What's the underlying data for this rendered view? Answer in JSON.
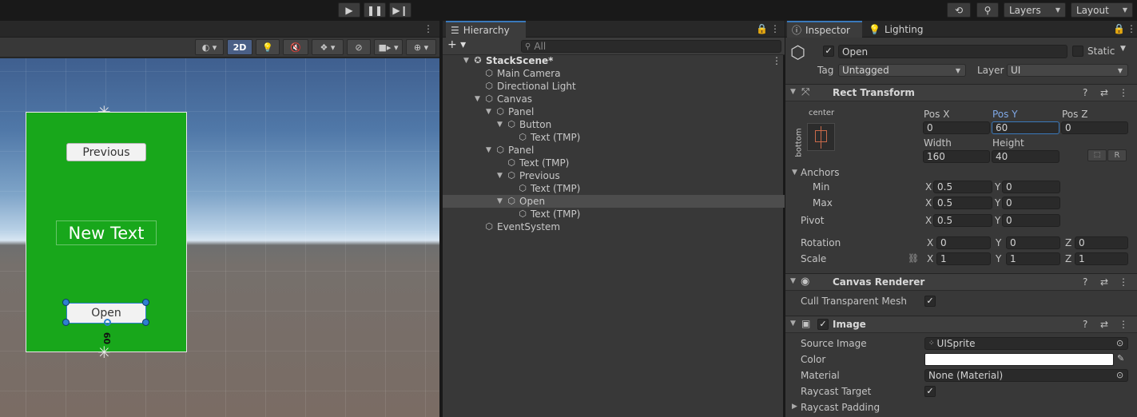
{
  "toolbar": {
    "play_icon": "play-icon",
    "pause_icon": "pause-icon",
    "step_icon": "step-icon",
    "layers_label": "Layers",
    "layout_label": "Layout"
  },
  "scene": {
    "mode_2d": "2D",
    "buttons": {
      "previous": "Previous",
      "open": "Open"
    },
    "text": "New Text",
    "distance_label": "60"
  },
  "hierarchy": {
    "tab": "Hierarchy",
    "search_placeholder": "All",
    "items": [
      {
        "label": "StackScene*",
        "depth": 0,
        "expanded": true,
        "scene": true
      },
      {
        "label": "Main Camera",
        "depth": 1
      },
      {
        "label": "Directional Light",
        "depth": 1
      },
      {
        "label": "Canvas",
        "depth": 1,
        "expanded": true
      },
      {
        "label": "Panel",
        "depth": 2,
        "expanded": true
      },
      {
        "label": "Button",
        "depth": 3,
        "expanded": true
      },
      {
        "label": "Text (TMP)",
        "depth": 4
      },
      {
        "label": "Panel",
        "depth": 2,
        "expanded": true
      },
      {
        "label": "Text (TMP)",
        "depth": 3
      },
      {
        "label": "Previous",
        "depth": 3,
        "expanded": true
      },
      {
        "label": "Text (TMP)",
        "depth": 4
      },
      {
        "label": "Open",
        "depth": 3,
        "expanded": true,
        "selected": true
      },
      {
        "label": "Text (TMP)",
        "depth": 4
      },
      {
        "label": "EventSystem",
        "depth": 1
      }
    ]
  },
  "inspector": {
    "tab": "Inspector",
    "lighting_tab": "Lighting",
    "object_name": "Open",
    "static_label": "Static",
    "tag_label": "Tag",
    "tag_value": "Untagged",
    "layer_label": "Layer",
    "layer_value": "UI",
    "rect_transform": {
      "title": "Rect Transform",
      "anchor_h": "center",
      "anchor_v": "bottom",
      "pos_x_label": "Pos X",
      "pos_y_label": "Pos Y",
      "pos_z_label": "Pos Z",
      "pos_x": "0",
      "pos_y": "60",
      "pos_z": "0",
      "width_label": "Width",
      "height_label": "Height",
      "width": "160",
      "height": "40",
      "anchors_label": "Anchors",
      "min_label": "Min",
      "max_label": "Max",
      "min_x": "0.5",
      "min_y": "0",
      "max_x": "0.5",
      "max_y": "0",
      "pivot_label": "Pivot",
      "pivot_x": "0.5",
      "pivot_y": "0",
      "rotation_label": "Rotation",
      "rot_x": "0",
      "rot_y": "0",
      "rot_z": "0",
      "scale_label": "Scale",
      "scale_x": "1",
      "scale_y": "1",
      "scale_z": "1",
      "x": "X",
      "y": "Y",
      "z": "Z",
      "r_button": "R"
    },
    "canvas_renderer": {
      "title": "Canvas Renderer",
      "cull_label": "Cull Transparent Mesh"
    },
    "image": {
      "title": "Image",
      "source_label": "Source Image",
      "source_value": "UISprite",
      "color_label": "Color",
      "color_value": "#ffffff",
      "material_label": "Material",
      "material_value": "None (Material)",
      "raycast_label": "Raycast Target",
      "padding_label": "Raycast Padding"
    }
  }
}
